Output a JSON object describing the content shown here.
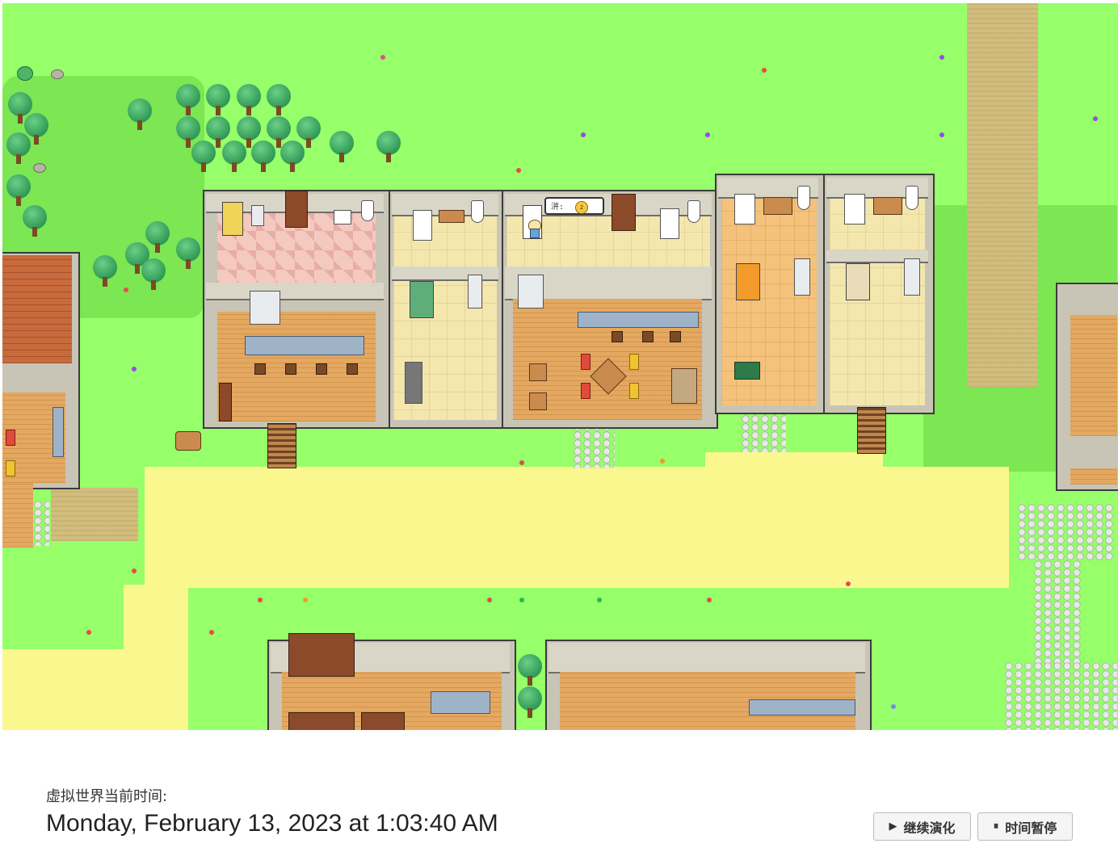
{
  "world": {
    "agent_bubble_text": "洴:",
    "agent_bubble_emoji": "😴"
  },
  "panel": {
    "time_label": "虚拟世界当前时间:",
    "time_value": "Monday, February 13, 2023 at 1:03:40 AM"
  },
  "controls": {
    "continue_icon": "▶",
    "continue_label": "继续演化",
    "pause_icon": "⏸",
    "pause_label": "时间暂停"
  }
}
